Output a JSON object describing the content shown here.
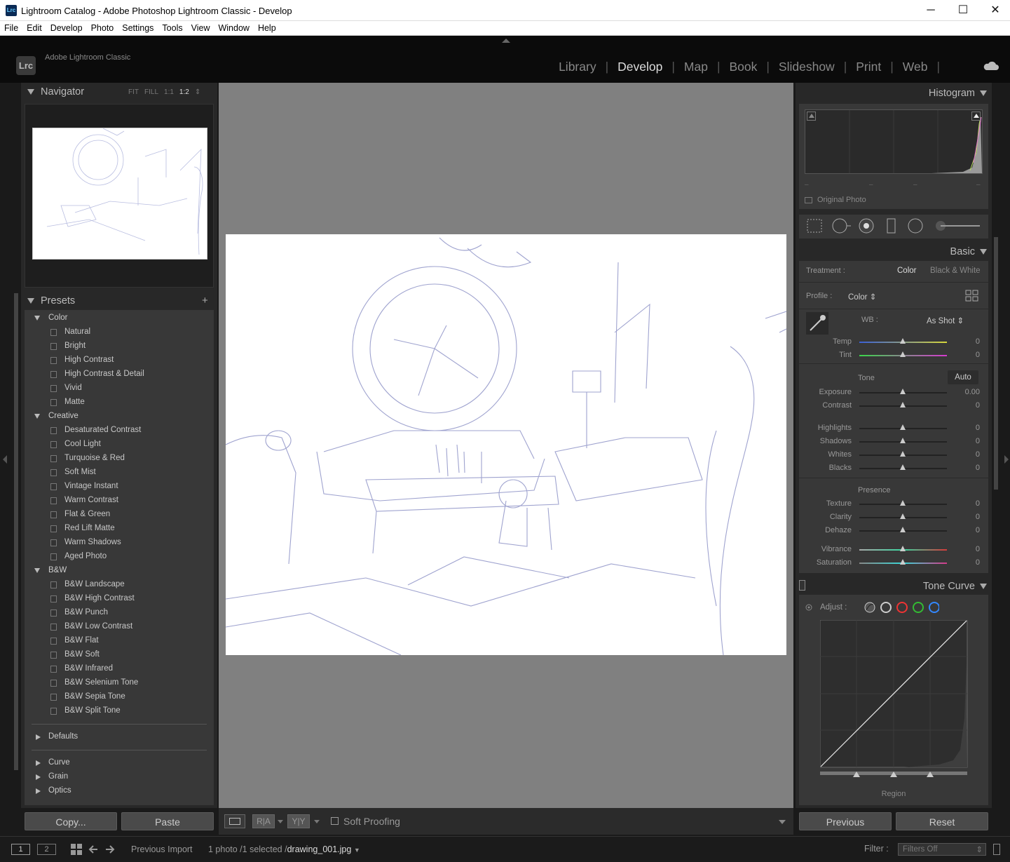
{
  "window": {
    "title": "Lightroom Catalog - Adobe Photoshop Lightroom Classic - Develop",
    "app_icon": "Lrc",
    "minimize": "─",
    "maximize": "☐",
    "close": "✕"
  },
  "menu": [
    "File",
    "Edit",
    "Develop",
    "Photo",
    "Settings",
    "Tools",
    "View",
    "Window",
    "Help"
  ],
  "brand": {
    "logo": "Lrc",
    "name": "Adobe Lightroom Classic"
  },
  "modules": [
    "Library",
    "Develop",
    "Map",
    "Book",
    "Slideshow",
    "Print",
    "Web"
  ],
  "active_module": "Develop",
  "navigator": {
    "title": "Navigator",
    "zoom": [
      "FIT",
      "FILL",
      "1:1",
      "1:2"
    ],
    "zoom_selected": "1:2"
  },
  "presets": {
    "title": "Presets",
    "add": "+",
    "groups": [
      {
        "name": "Color",
        "open": true,
        "items": [
          "Natural",
          "Bright",
          "High Contrast",
          "High Contrast & Detail",
          "Vivid",
          "Matte"
        ]
      },
      {
        "name": "Creative",
        "open": true,
        "items": [
          "Desaturated Contrast",
          "Cool Light",
          "Turquoise & Red",
          "Soft Mist",
          "Vintage Instant",
          "Warm Contrast",
          "Flat & Green",
          "Red Lift Matte",
          "Warm Shadows",
          "Aged Photo"
        ]
      },
      {
        "name": "B&W",
        "open": true,
        "items": [
          "B&W Landscape",
          "B&W High Contrast",
          "B&W Punch",
          "B&W Low Contrast",
          "B&W Flat",
          "B&W Soft",
          "B&W Infrared",
          "B&W Selenium Tone",
          "B&W Sepia Tone",
          "B&W Split Tone"
        ]
      }
    ],
    "closed_groups": [
      "Defaults"
    ],
    "closed_groups2": [
      "Curve",
      "Grain",
      "Optics"
    ]
  },
  "left_buttons": {
    "copy": "Copy...",
    "paste": "Paste"
  },
  "toolbar": {
    "soft_proofing": "Soft Proofing",
    "ra": "R|A",
    "yy": "Y|Y"
  },
  "histogram": {
    "title": "Histogram",
    "original_photo": "Original Photo"
  },
  "basic": {
    "title": "Basic",
    "treatment_label": "Treatment :",
    "treatment_color": "Color",
    "treatment_bw": "Black & White",
    "profile_label": "Profile :",
    "profile_value": "Color",
    "wb_label": "WB :",
    "wb_value": "As Shot",
    "wb_sliders": [
      {
        "name": "Temp",
        "value": "0"
      },
      {
        "name": "Tint",
        "value": "0"
      }
    ],
    "tone_label": "Tone",
    "auto": "Auto",
    "tone_sliders": [
      {
        "name": "Exposure",
        "value": "0.00"
      },
      {
        "name": "Contrast",
        "value": "0"
      }
    ],
    "tone_sliders2": [
      {
        "name": "Highlights",
        "value": "0"
      },
      {
        "name": "Shadows",
        "value": "0"
      },
      {
        "name": "Whites",
        "value": "0"
      },
      {
        "name": "Blacks",
        "value": "0"
      }
    ],
    "presence_label": "Presence",
    "presence_sliders": [
      {
        "name": "Texture",
        "value": "0"
      },
      {
        "name": "Clarity",
        "value": "0"
      },
      {
        "name": "Dehaze",
        "value": "0"
      }
    ],
    "presence_sliders2": [
      {
        "name": "Vibrance",
        "value": "0"
      },
      {
        "name": "Saturation",
        "value": "0"
      }
    ]
  },
  "tone_curve": {
    "title": "Tone Curve",
    "adjust_label": "Adjust :",
    "region": "Region"
  },
  "right_buttons": {
    "previous": "Previous",
    "reset": "Reset"
  },
  "filmstrip": {
    "screen1": "1",
    "screen2": "2",
    "source": "Previous Import",
    "count": "1 photo /1 selected /",
    "filename": "drawing_001.jpg",
    "filter_label": "Filter :",
    "filter_value": "Filters Off"
  },
  "colors": {
    "accent": "#dddddd",
    "panel": "#383838",
    "bg": "#282828"
  }
}
